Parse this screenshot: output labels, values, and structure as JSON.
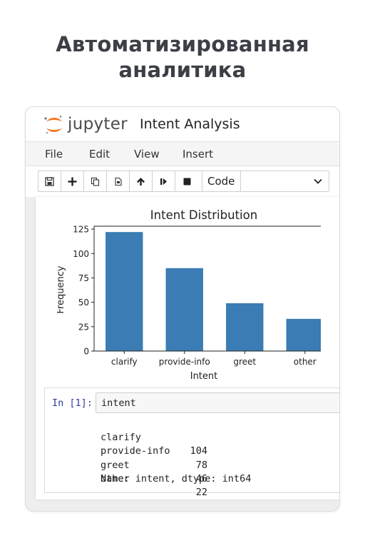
{
  "headline": {
    "line1": "Автоматизированная",
    "line2": "аналитика"
  },
  "app": {
    "logo_text": "jupyter",
    "notebook_title": "Intent Analysis"
  },
  "menu": [
    "File",
    "Edit",
    "View",
    "Insert"
  ],
  "toolbar": {
    "buttons": [
      "save-icon",
      "plus-icon",
      "cut-icon",
      "copy-icon",
      "arrow-up-icon",
      "arrow-down-icon",
      "stop-icon"
    ],
    "cell_type": "Code"
  },
  "chart_data": {
    "type": "bar",
    "title": "Intent Distribution",
    "xlabel": "Intent",
    "ylabel": "Frequency",
    "categories": [
      "clarify",
      "provide-info",
      "greet",
      "other"
    ],
    "values": [
      122,
      85,
      49,
      33
    ],
    "ylim": [
      0,
      128
    ],
    "yticks": [
      0,
      25,
      50,
      75,
      100,
      125
    ],
    "bar_color": "#3a7cb3",
    "grid": false
  },
  "cell": {
    "prompt": "In [1]:",
    "code": "intent",
    "output_rows": [
      {
        "name": "clarify",
        "value": "104"
      },
      {
        "name": "provide-info",
        "value": "78"
      },
      {
        "name": "greet",
        "value": "46"
      },
      {
        "name": "other",
        "value": "22"
      }
    ],
    "output_footer": "Name: intent, dtype: int64"
  }
}
